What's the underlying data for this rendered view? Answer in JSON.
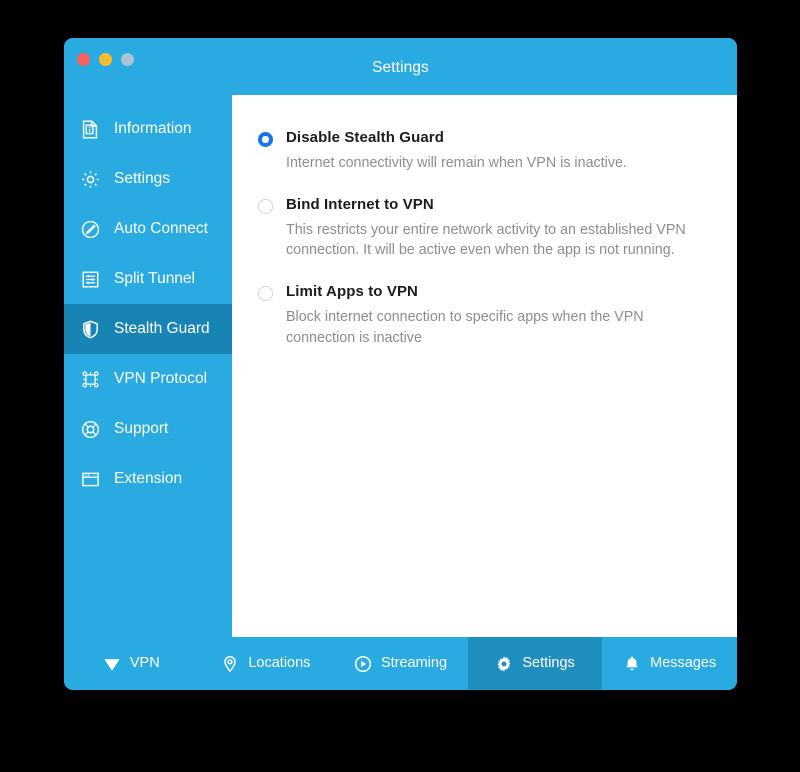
{
  "window": {
    "title": "Settings",
    "traffic_lights": [
      {
        "name": "close",
        "color": "#f9615c"
      },
      {
        "name": "minimize",
        "color": "#f7bb2e"
      },
      {
        "name": "maximize",
        "color": "#a9c4d3"
      }
    ]
  },
  "colors": {
    "brand_blue": "#29abe2",
    "sidebar_active": "#1785b4",
    "tab_active": "#1f8fc0",
    "radio_selected": "#1a73e8",
    "content_bg": "#ffffff",
    "desktop_bg": "#000000",
    "title_text": "#1c1c1e",
    "desc_text": "#8c8c92"
  },
  "sidebar": {
    "items": [
      {
        "label": "Information",
        "icon": "document-info-icon",
        "active": false
      },
      {
        "label": "Settings",
        "icon": "gear-icon",
        "active": false
      },
      {
        "label": "Auto Connect",
        "icon": "pencil-circle-icon",
        "active": false
      },
      {
        "label": "Split Tunnel",
        "icon": "sliders-panel-icon",
        "active": false
      },
      {
        "label": "Stealth Guard",
        "icon": "shield-icon",
        "active": true
      },
      {
        "label": "VPN Protocol",
        "icon": "network-nodes-icon",
        "active": false
      },
      {
        "label": "Support",
        "icon": "lifebuoy-icon",
        "active": false
      },
      {
        "label": "Extension",
        "icon": "browser-window-icon",
        "active": false
      }
    ]
  },
  "content": {
    "options": [
      {
        "title": "Disable Stealth Guard",
        "description": "Internet connectivity will remain when VPN is inactive.",
        "selected": true
      },
      {
        "title": "Bind Internet to VPN",
        "description": "This restricts your entire network activity to an established VPN connection. It will be active even when the app is not running.",
        "selected": false
      },
      {
        "title": "Limit Apps to VPN",
        "description": "Block internet connection to specific apps when the VPN connection is inactive",
        "selected": false
      }
    ]
  },
  "bottom_nav": {
    "tabs": [
      {
        "label": "VPN",
        "icon": "paper-plane-icon",
        "active": false
      },
      {
        "label": "Locations",
        "icon": "map-pin-icon",
        "active": false
      },
      {
        "label": "Streaming",
        "icon": "play-circle-icon",
        "active": false
      },
      {
        "label": "Settings",
        "icon": "gear-icon",
        "active": true
      },
      {
        "label": "Messages",
        "icon": "bell-icon",
        "active": false
      }
    ]
  }
}
